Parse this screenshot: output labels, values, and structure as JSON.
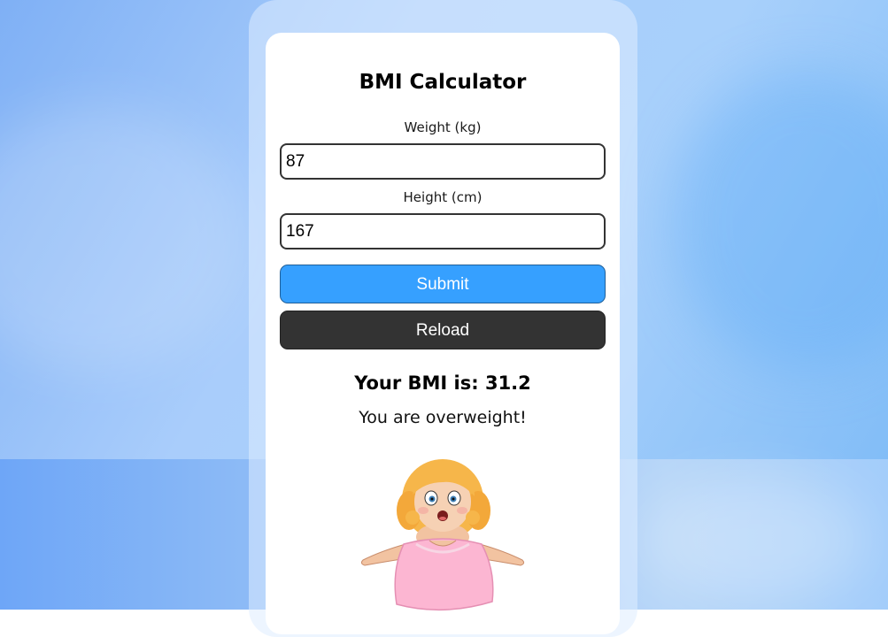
{
  "app": {
    "title": "BMI Calculator"
  },
  "form": {
    "weight_label": "Weight (kg)",
    "weight_value": "87",
    "height_label": "Height (cm)",
    "height_value": "167",
    "submit_label": "Submit",
    "reload_label": "Reload"
  },
  "result": {
    "bmi_text": "Your BMI is: 31.2",
    "message": "You are overweight!"
  },
  "colors": {
    "submit_button": "#36a0ff",
    "reload_button": "#333333",
    "background": "#a9cdfb"
  }
}
